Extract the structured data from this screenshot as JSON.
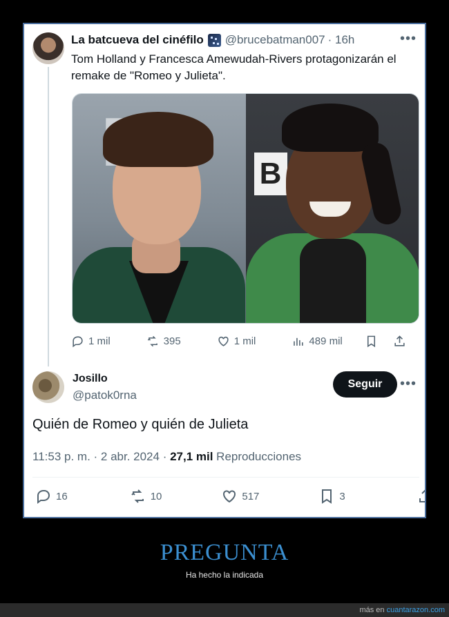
{
  "quoted_tweet": {
    "author_name": "La batcueva del cinéfilo",
    "handle": "@brucebatman007",
    "time": "· 16h",
    "more": "•••",
    "text": "Tom Holland y Francesca Amewudah-Rivers protagonizarán el remake de \"Romeo y Julieta\".",
    "actions": {
      "replies": "1 mil",
      "retweets": "395",
      "likes": "1 mil",
      "views": "489 mil"
    }
  },
  "main_tweet": {
    "author_name": "Josillo",
    "handle": "@patok0rna",
    "follow_label": "Seguir",
    "more": "•••",
    "text": "Quién de Romeo y quién de Julieta",
    "timestamp": "11:53 p. m. · 2 abr. 2024 · ",
    "views_count": "27,1 mil",
    "views_label": " Reproducciones",
    "actions": {
      "replies": "16",
      "retweets": "10",
      "likes": "517",
      "bookmarks": "3"
    }
  },
  "caption": {
    "title": "PREGUNTA",
    "subtitle": "Ha hecho la indicada"
  },
  "footer": {
    "credit_prefix": "más en ",
    "credit_site": "cuantarazon.com"
  },
  "colors": {
    "background": "#000000",
    "card_border": "#4a6d9c",
    "caption_title": "#3b8fd0",
    "follow_button": "#0f1419",
    "muted_text": "#536471"
  }
}
